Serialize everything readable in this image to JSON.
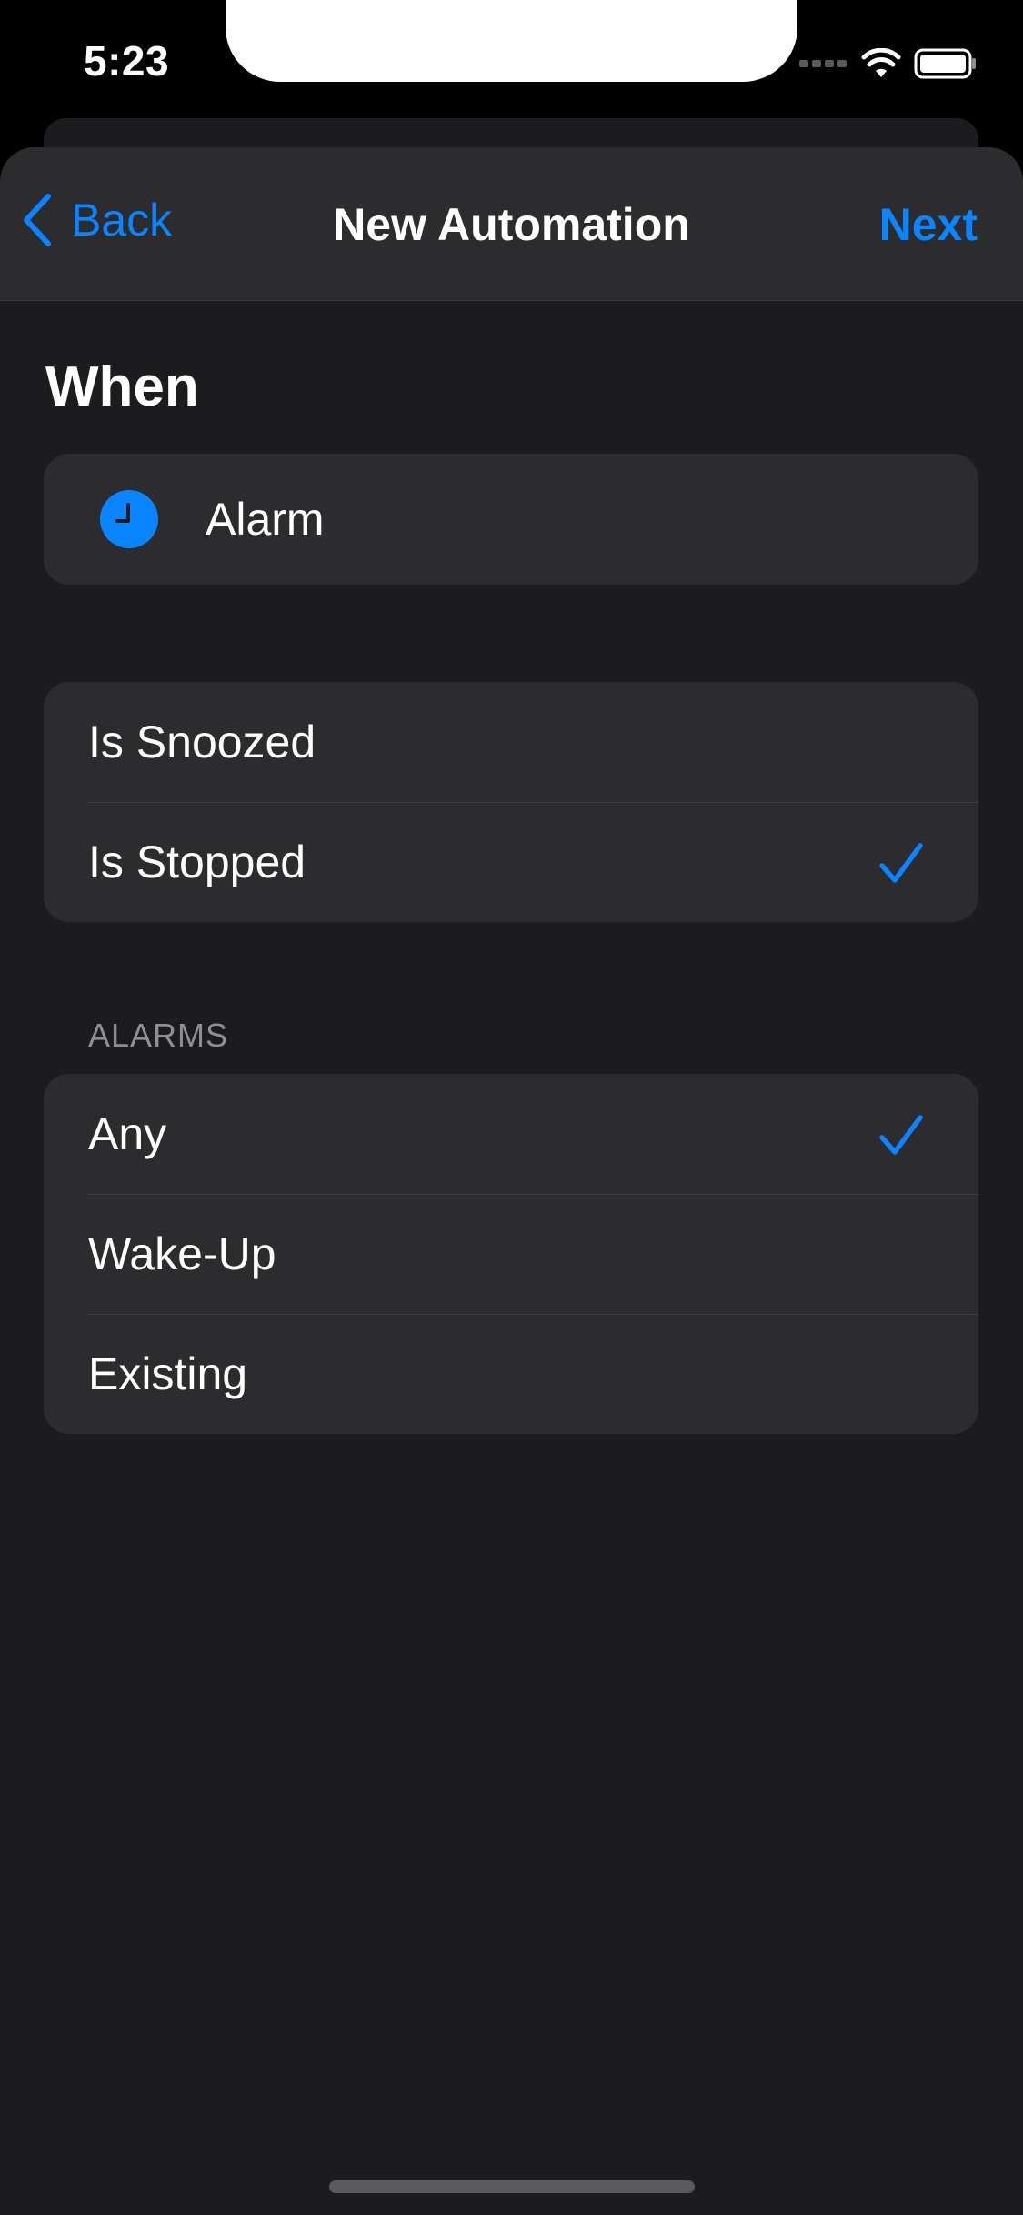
{
  "status_bar": {
    "time": "5:23",
    "icons": [
      "signal-dots-icon",
      "wifi-icon",
      "battery-icon"
    ]
  },
  "nav": {
    "back_label": "Back",
    "title": "New Automation",
    "next_label": "Next"
  },
  "section": {
    "title": "When"
  },
  "trigger": {
    "icon": "clock-icon",
    "label": "Alarm"
  },
  "event_options": [
    {
      "label": "Is Snoozed",
      "checked": false
    },
    {
      "label": "Is Stopped",
      "checked": true
    }
  ],
  "alarms": {
    "header": "ALARMS",
    "options": [
      {
        "label": "Any",
        "checked": true
      },
      {
        "label": "Wake-Up",
        "checked": false
      },
      {
        "label": "Existing",
        "checked": false
      }
    ]
  },
  "colors": {
    "accent": "#0a84ff",
    "background": "#1c1c1e",
    "cell": "#2c2c2e",
    "secondary_text": "#8e8e93"
  }
}
